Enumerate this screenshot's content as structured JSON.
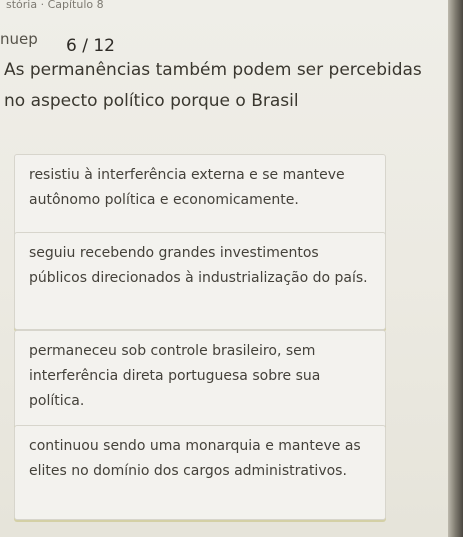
{
  "header": {
    "breadcrumb": "stória · Capítulo 8",
    "app_label": "nuep",
    "progress": "6 / 12"
  },
  "question": {
    "text": "As permanências também podem ser percebidas no aspecto político porque o Brasil"
  },
  "options": [
    {
      "text": "resistiu à interferência externa e se manteve autônomo política e economicamente."
    },
    {
      "text": "seguiu recebendo grandes investimentos públicos direcionados à industrialização do país."
    },
    {
      "text": "permaneceu sob controle brasileiro, sem interferência direta portuguesa sobre sua política."
    },
    {
      "text": "continuou sendo uma monarquia e manteve as elites no domínio dos cargos administrativos."
    }
  ]
}
